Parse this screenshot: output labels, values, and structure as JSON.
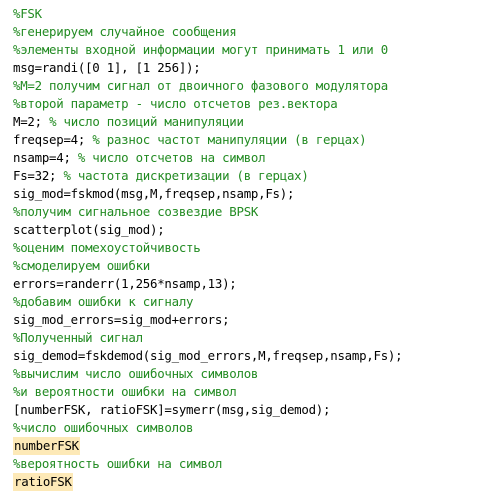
{
  "editor": {
    "lines": [
      {
        "type": "comment",
        "text": "%FSK"
      },
      {
        "type": "comment",
        "text": "%генерируем случайное сообщения"
      },
      {
        "type": "comment",
        "text": "%элементы входной информации могут принимать 1 или 0"
      },
      {
        "type": "code",
        "text": "msg=randi([0 1], [1 256]);",
        "comment": ""
      },
      {
        "type": "comment",
        "text": "%M=2 получим сигнал от двоичного фазового модулятора"
      },
      {
        "type": "comment",
        "text": "%второй параметр - число отсчетов рез.вектора"
      },
      {
        "type": "code",
        "text": "M=2; ",
        "comment": "% число позиций манипуляции"
      },
      {
        "type": "code",
        "text": "freqsep=4; ",
        "comment": "% разнос частот манипуляции (в герцах)"
      },
      {
        "type": "code",
        "text": "nsamp=4; ",
        "comment": "% число отсчетов на символ"
      },
      {
        "type": "code",
        "text": "Fs=32; ",
        "comment": "% частота дискретизации (в герцах)"
      },
      {
        "type": "code",
        "text": "sig_mod=fskmod(msg,M,freqsep,nsamp,Fs);",
        "comment": ""
      },
      {
        "type": "comment",
        "text": "%получим сигнальное созвездие BPSK"
      },
      {
        "type": "code",
        "text": "scatterplot(sig_mod);",
        "comment": ""
      },
      {
        "type": "comment",
        "text": "%оценим помехоустойчивость"
      },
      {
        "type": "comment",
        "text": "%смоделируем ошибки"
      },
      {
        "type": "code",
        "text": "errors=randerr(1,256*nsamp,13);",
        "comment": ""
      },
      {
        "type": "comment",
        "text": "%добавим ошибки к сигналу"
      },
      {
        "type": "code",
        "text": "sig_mod_errors=sig_mod+errors;",
        "comment": ""
      },
      {
        "type": "comment",
        "text": "%Полученный сигнал"
      },
      {
        "type": "code",
        "text": "sig_demod=fskdemod(sig_mod_errors,M,freqsep,nsamp,Fs);",
        "comment": ""
      },
      {
        "type": "comment",
        "text": "%вычислим число ошибочных символов"
      },
      {
        "type": "comment",
        "text": "%и вероятности ошибки на символ"
      },
      {
        "type": "code",
        "text": "[numberFSK, ratioFSK]=symerr(msg,sig_demod);",
        "comment": ""
      },
      {
        "type": "comment",
        "text": "%число ошибочных символов"
      },
      {
        "type": "highlight",
        "text": "numberFSK"
      },
      {
        "type": "comment",
        "text": "%вероятность ошибки на символ"
      },
      {
        "type": "highlight",
        "text": "ratioFSK"
      }
    ]
  }
}
